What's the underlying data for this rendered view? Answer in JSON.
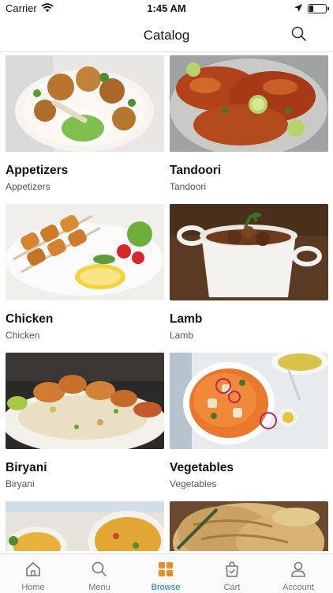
{
  "status_bar": {
    "carrier": "Carrier",
    "time": "1:45 AM"
  },
  "header": {
    "title": "Catalog",
    "search_icon": "search-icon"
  },
  "colors": {
    "accent": "#1a73e8",
    "browse_icon": "#f08a24",
    "tab_inactive": "#777777"
  },
  "categories": [
    {
      "name": "Appetizers",
      "subtitle": "Appetizers"
    },
    {
      "name": "Tandoori",
      "subtitle": "Tandoori"
    },
    {
      "name": "Chicken",
      "subtitle": "Chicken"
    },
    {
      "name": "Lamb",
      "subtitle": "Lamb"
    },
    {
      "name": "Biryani",
      "subtitle": "Biryani"
    },
    {
      "name": "Vegetables",
      "subtitle": "Vegetables"
    }
  ],
  "tabs": [
    {
      "label": "Home",
      "icon": "home-icon"
    },
    {
      "label": "Menu",
      "icon": "search-icon"
    },
    {
      "label": "Browse",
      "icon": "grid-icon",
      "active": true
    },
    {
      "label": "Cart",
      "icon": "bag-icon"
    },
    {
      "label": "Account",
      "icon": "user-icon"
    }
  ]
}
